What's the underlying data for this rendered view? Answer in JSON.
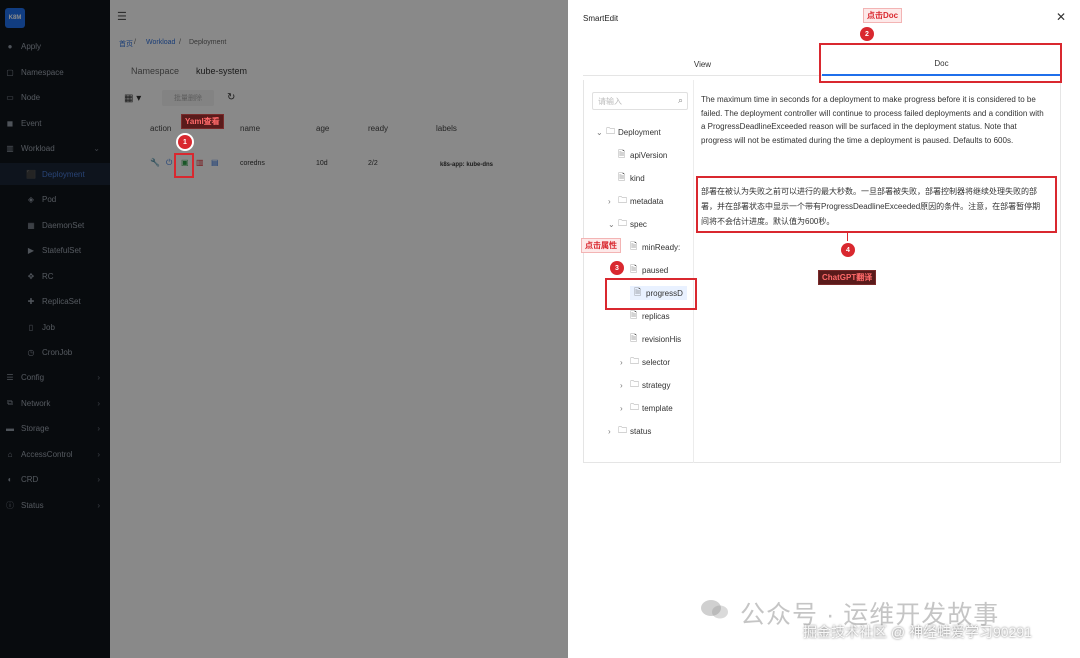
{
  "app": {
    "logo_text": "K8M"
  },
  "sidebar": {
    "items": [
      {
        "label": "Apply",
        "icon": "apply-icon"
      },
      {
        "label": "Namespace",
        "icon": "namespace-icon"
      },
      {
        "label": "Node",
        "icon": "node-icon"
      },
      {
        "label": "Event",
        "icon": "event-icon"
      },
      {
        "label": "Workload",
        "icon": "workload-icon"
      },
      {
        "label": "Deployment",
        "icon": "deployment-icon"
      },
      {
        "label": "Pod",
        "icon": "pod-icon"
      },
      {
        "label": "DaemonSet",
        "icon": "daemonset-icon"
      },
      {
        "label": "StatefulSet",
        "icon": "statefulset-icon"
      },
      {
        "label": "RC",
        "icon": "rc-icon"
      },
      {
        "label": "ReplicaSet",
        "icon": "replicaset-icon"
      },
      {
        "label": "Job",
        "icon": "job-icon"
      },
      {
        "label": "CronJob",
        "icon": "cronjob-icon"
      },
      {
        "label": "Config",
        "icon": "config-icon"
      },
      {
        "label": "Network",
        "icon": "network-icon"
      },
      {
        "label": "Storage",
        "icon": "storage-icon"
      },
      {
        "label": "AccessControl",
        "icon": "access-control-icon"
      },
      {
        "label": "CRD",
        "icon": "crd-icon"
      },
      {
        "label": "Status",
        "icon": "status-icon"
      }
    ],
    "active": "Deployment"
  },
  "main": {
    "breadcrumb": [
      "首页",
      "Workload",
      "Deployment"
    ],
    "namespace_label": "Namespace",
    "namespace_value": "kube-system",
    "batch_delete": "批量删除",
    "columns": [
      "action",
      "name",
      "age",
      "ready",
      "labels"
    ],
    "rows": [
      {
        "name": "coredns",
        "age": "10d",
        "ready": "2/2",
        "labels": "k8s-app: kube-dns"
      }
    ]
  },
  "panel": {
    "title": "SmartEdit",
    "tabs": [
      "View",
      "Doc"
    ],
    "active_tab": "Doc",
    "search_placeholder": "请输入",
    "tree": [
      {
        "label": "Deployment",
        "depth": 0,
        "type": "folder",
        "expanded": true
      },
      {
        "label": "apiVersion",
        "depth": 1,
        "type": "file"
      },
      {
        "label": "kind",
        "depth": 1,
        "type": "file"
      },
      {
        "label": "metadata",
        "depth": 1,
        "type": "folder",
        "expanded": false
      },
      {
        "label": "spec",
        "depth": 1,
        "type": "folder",
        "expanded": true
      },
      {
        "label": "minReady:",
        "depth": 2,
        "type": "file"
      },
      {
        "label": "paused",
        "depth": 2,
        "type": "file"
      },
      {
        "label": "progressD",
        "depth": 2,
        "type": "file",
        "selected": true
      },
      {
        "label": "replicas",
        "depth": 2,
        "type": "file"
      },
      {
        "label": "revisionHis",
        "depth": 2,
        "type": "file"
      },
      {
        "label": "selector",
        "depth": 2,
        "type": "folder",
        "expanded": false
      },
      {
        "label": "strategy",
        "depth": 2,
        "type": "folder",
        "expanded": false
      },
      {
        "label": "template",
        "depth": 2,
        "type": "folder",
        "expanded": false
      },
      {
        "label": "status",
        "depth": 1,
        "type": "folder",
        "expanded": false
      }
    ],
    "doc_en": "The maximum time in seconds for a deployment to make progress before it is considered to be failed. The deployment controller will continue to process failed deployments and a condition with a ProgressDeadlineExceeded reason will be surfaced in the deployment status. Note that progress will not be estimated during the time a deployment is paused. Defaults to 600s.",
    "doc_cn": "部署在被认为失败之前可以进行的最大秒数。一旦部署被失败，部署控制器将继续处理失败的部署，并在部署状态中显示一个带有ProgressDeadlineExceeded原因的条件。注意，在部署暂停期间将不会估计进度。默认值为600秒。"
  },
  "annotations": [
    {
      "number": "1",
      "label": "Yaml查看"
    },
    {
      "number": "2",
      "label": "点击Doc"
    },
    {
      "number": "3",
      "label": "点击属性"
    },
    {
      "number": "4",
      "label": "ChatGPT翻译"
    }
  ],
  "watermark": {
    "main": "公众号 · 运维开发故事",
    "sub": "掘金技术社区 @ 神经蛙爱学习90291"
  },
  "colors": {
    "accent": "#1f6feb",
    "annotation": "#d9282f",
    "sidebar_bg": "#10141b"
  }
}
